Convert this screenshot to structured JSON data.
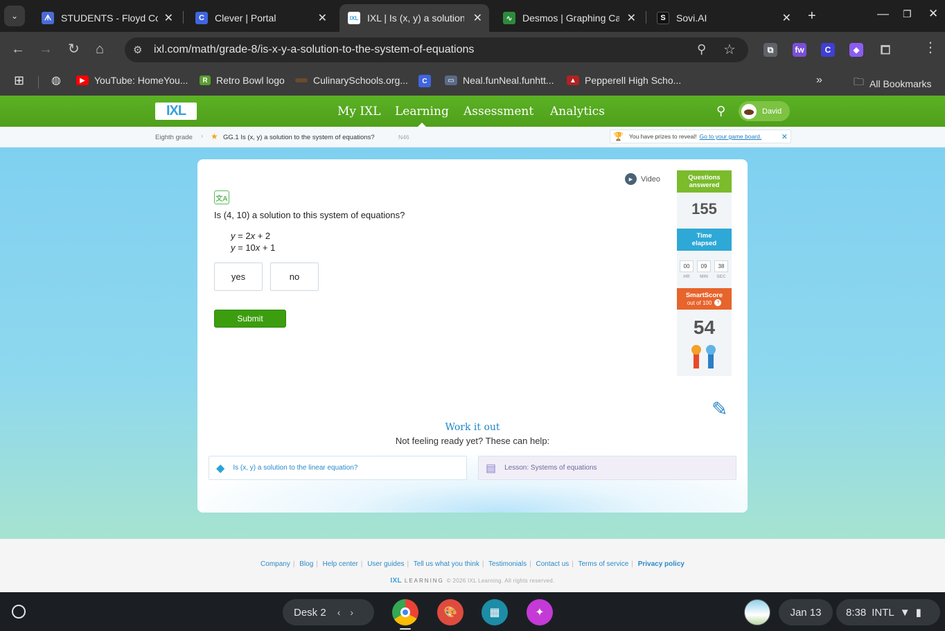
{
  "browser": {
    "tabs": [
      {
        "title": "STUDENTS - Floyd Cou",
        "favicon": "floyd-logo-icon",
        "color": "#4b6bd6",
        "active": false
      },
      {
        "title": "Clever | Portal",
        "favicon": "clever-icon",
        "color": "#3f65e0",
        "active": false
      },
      {
        "title": "IXL | Is (x, y) a solution",
        "favicon": "ixl-icon",
        "color": "#ffffff",
        "active": true
      },
      {
        "title": "Desmos | Graphing Cal",
        "favicon": "desmos-icon",
        "color": "#2d8a3c",
        "active": false
      },
      {
        "title": "Sovi.AI",
        "favicon": "sovi-icon",
        "color": "#111111",
        "active": false
      }
    ],
    "url": "ixl.com/math/grade-8/is-x-y-a-solution-to-the-system-of-equations",
    "bookmarks": [
      {
        "label": "YouTube: HomeYou...",
        "icon": "youtube-icon",
        "color": "#ff0000"
      },
      {
        "label": "Retro Bowl logo",
        "icon": "retro-bowl-icon",
        "color": "#5a9e2f"
      },
      {
        "label": "CulinarySchools.org...",
        "icon": "culinary-icon",
        "color": "#6b4a2e"
      },
      {
        "label": "",
        "icon": "clever-icon",
        "color": "#3f65e0"
      },
      {
        "label": "Neal.funNeal.funhtt...",
        "icon": "laptop-icon",
        "color": "#5a6b8a"
      },
      {
        "label": "Pepperell High Scho...",
        "icon": "pepperell-icon",
        "color": "#b22222"
      }
    ],
    "all_bookmarks": "All Bookmarks"
  },
  "ixl": {
    "logo": "IXL",
    "nav": [
      "My IXL",
      "Learning",
      "Assessment",
      "Analytics"
    ],
    "user": "David",
    "breadcrumb": {
      "grade": "Eighth grade",
      "skill": "GG.1 Is (x, y) a solution to the system of equations?",
      "code": "N46"
    },
    "prize": {
      "text": "You have prizes to reveal!",
      "link": "Go to your game board."
    },
    "practice": {
      "video": "Video",
      "question": "Is (4, 10) a solution to this system of equations?",
      "equations": [
        {
          "lhs": "y",
          "rhs_coef": "2",
          "var": "x",
          "rhs_const": "+ 2"
        },
        {
          "lhs": "y",
          "rhs_coef": "10",
          "var": "x",
          "rhs_const": "+ 1"
        }
      ],
      "answers": [
        "yes",
        "no"
      ],
      "submit": "Submit",
      "work_it_out": "Work it out",
      "not_ready": "Not feeling ready yet? These can help:",
      "help_links": [
        "Is (x, y) a solution to the linear equation?",
        "Lesson: Systems of equations"
      ]
    },
    "stats": {
      "questions_label_1": "Questions",
      "questions_label_2": "answered",
      "questions_answered": "155",
      "time_label_1": "Time",
      "time_label_2": "elapsed",
      "time": {
        "hr": "00",
        "min": "09",
        "sec": "38"
      },
      "time_units": {
        "hr": "HR",
        "min": "MIN",
        "sec": "SEC"
      },
      "smartscore_label": "SmartScore",
      "smartscore_sub": "out of 100",
      "smartscore": "54"
    },
    "footer": {
      "links": [
        "Company",
        "Blog",
        "Help center",
        "User guides",
        "Tell us what you think",
        "Testimonials",
        "Contact us",
        "Terms of service",
        "Privacy policy"
      ],
      "brand": "IXL",
      "learning": "LEARNING",
      "copyright": "© 2026 IXL Learning. All rights reserved."
    }
  },
  "os": {
    "desk": "Desk 2",
    "date": "Jan 13",
    "time": "8:38",
    "ime": "INTL"
  },
  "colors": {
    "ixl_green": "#56a81f",
    "submit_green": "#3c9d0e",
    "questions_green": "#7bbb2c",
    "time_blue": "#2ea8d6",
    "smartscore_orange": "#e7642c"
  }
}
